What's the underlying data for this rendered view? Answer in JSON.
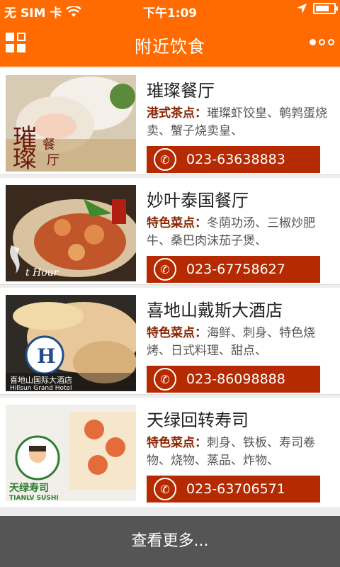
{
  "status_bar": {
    "carrier": "无 SIM 卡",
    "time": "下午1:09"
  },
  "header": {
    "title": "附近饮食"
  },
  "restaurants": [
    {
      "name": "璀璨餐厅",
      "tag": "港式茶点：",
      "desc": "璀璨虾饺皇、鹌鹑蛋烧卖、蟹子烧卖皇、",
      "phone": "023-63638883",
      "logo_text": "璀璨 餐厅"
    },
    {
      "name": "妙叶泰国餐厅",
      "tag": "特色菜点：",
      "desc": "冬荫功汤、三椒炒肥牛、桑巴肉沫茄子煲、",
      "phone": "023-67758627",
      "logo_text": "t Hour"
    },
    {
      "name": "喜地山戴斯大酒店",
      "tag": "特色菜点：",
      "desc": "海鲜、刺身、特色烧烤、日式料理、甜点、",
      "phone": "023-86098888",
      "logo_text": "喜地山国际大酒店 Hillsun Grand Hotel"
    },
    {
      "name": "天绿回转寿司",
      "tag": "特色菜点：",
      "desc": "刺身、铁板、寿司卷物、烧物、蒸品、炸物、",
      "phone": "023-63706571",
      "logo_text": "天绿寿司 TIANLV SUSHI"
    }
  ],
  "footer": {
    "more_label": "查看更多..."
  },
  "colors": {
    "accent": "#ff6b00",
    "button": "#b52a00",
    "footer": "#555555"
  }
}
